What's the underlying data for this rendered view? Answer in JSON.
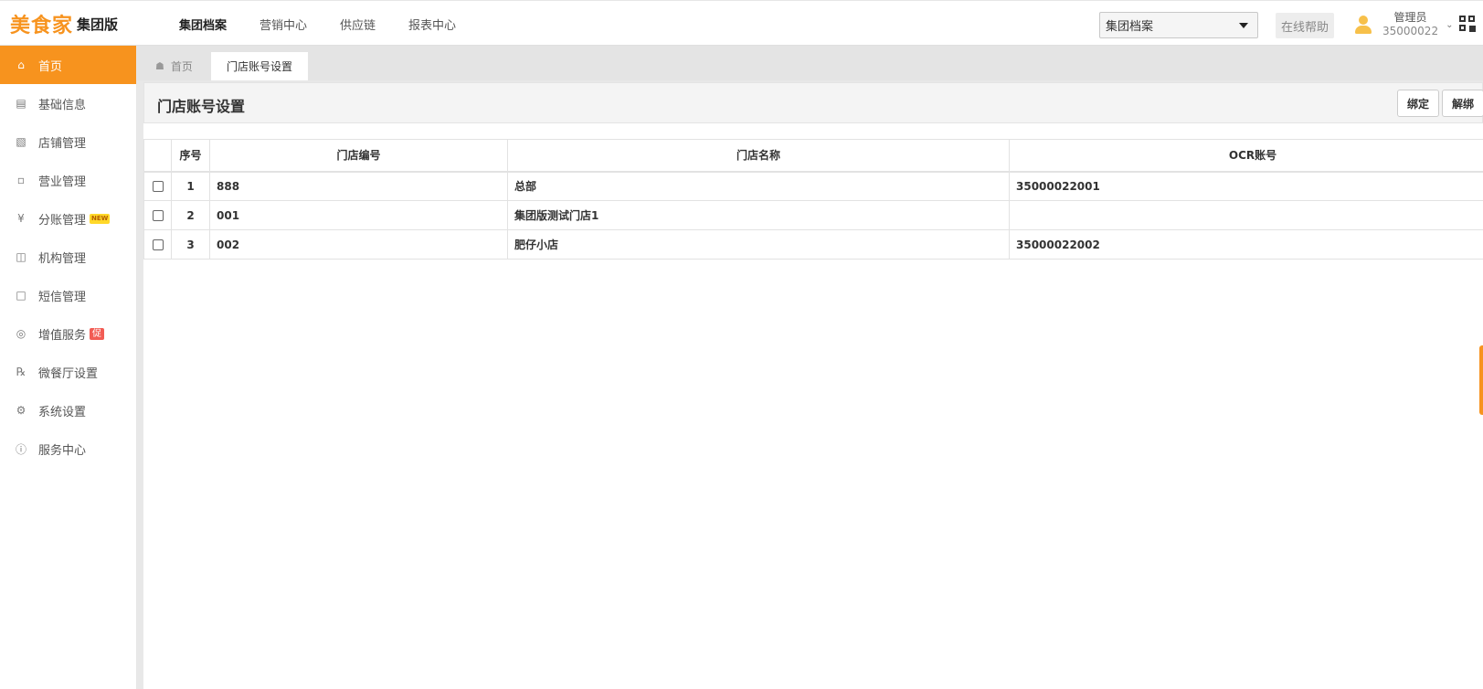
{
  "header": {
    "brand": "美食家",
    "edition": "集团版",
    "nav": [
      {
        "label": "集团档案",
        "active": true
      },
      {
        "label": "营销中心",
        "active": false
      },
      {
        "label": "供应链",
        "active": false
      },
      {
        "label": "报表中心",
        "active": false
      }
    ],
    "module_select": "集团档案",
    "help_label": "在线帮助",
    "user_role": "管理员",
    "user_id": "35000022",
    "accent_color": "#f7931e"
  },
  "sidebar": {
    "items": [
      {
        "label": "首页",
        "icon": "home-icon",
        "active": true
      },
      {
        "label": "基础信息",
        "icon": "document-icon"
      },
      {
        "label": "店铺管理",
        "icon": "store-icon"
      },
      {
        "label": "营业管理",
        "icon": "chat-icon"
      },
      {
        "label": "分账管理",
        "icon": "coin-icon",
        "badge": "NEW"
      },
      {
        "label": "机构管理",
        "icon": "building-icon"
      },
      {
        "label": "短信管理",
        "icon": "message-icon"
      },
      {
        "label": "增值服务",
        "icon": "target-icon",
        "badge": "促"
      },
      {
        "label": "微餐厅设置",
        "icon": "utensils-icon"
      },
      {
        "label": "系统设置",
        "icon": "gear-icon"
      },
      {
        "label": "服务中心",
        "icon": "question-icon"
      }
    ]
  },
  "tabs": {
    "home": "首页",
    "current": "门店账号设置"
  },
  "page": {
    "title": "门店账号设置",
    "bind_button": "绑定",
    "unbind_button": "解绑"
  },
  "table": {
    "columns": [
      "序号",
      "门店编号",
      "门店名称",
      "OCR账号"
    ],
    "rows": [
      {
        "index": "1",
        "store_code": "888",
        "store_name": "总部",
        "ocr_account": "35000022001"
      },
      {
        "index": "2",
        "store_code": "001",
        "store_name": "集团版测试门店1",
        "ocr_account": ""
      },
      {
        "index": "3",
        "store_code": "002",
        "store_name": "肥仔小店",
        "ocr_account": "35000022002"
      }
    ]
  }
}
